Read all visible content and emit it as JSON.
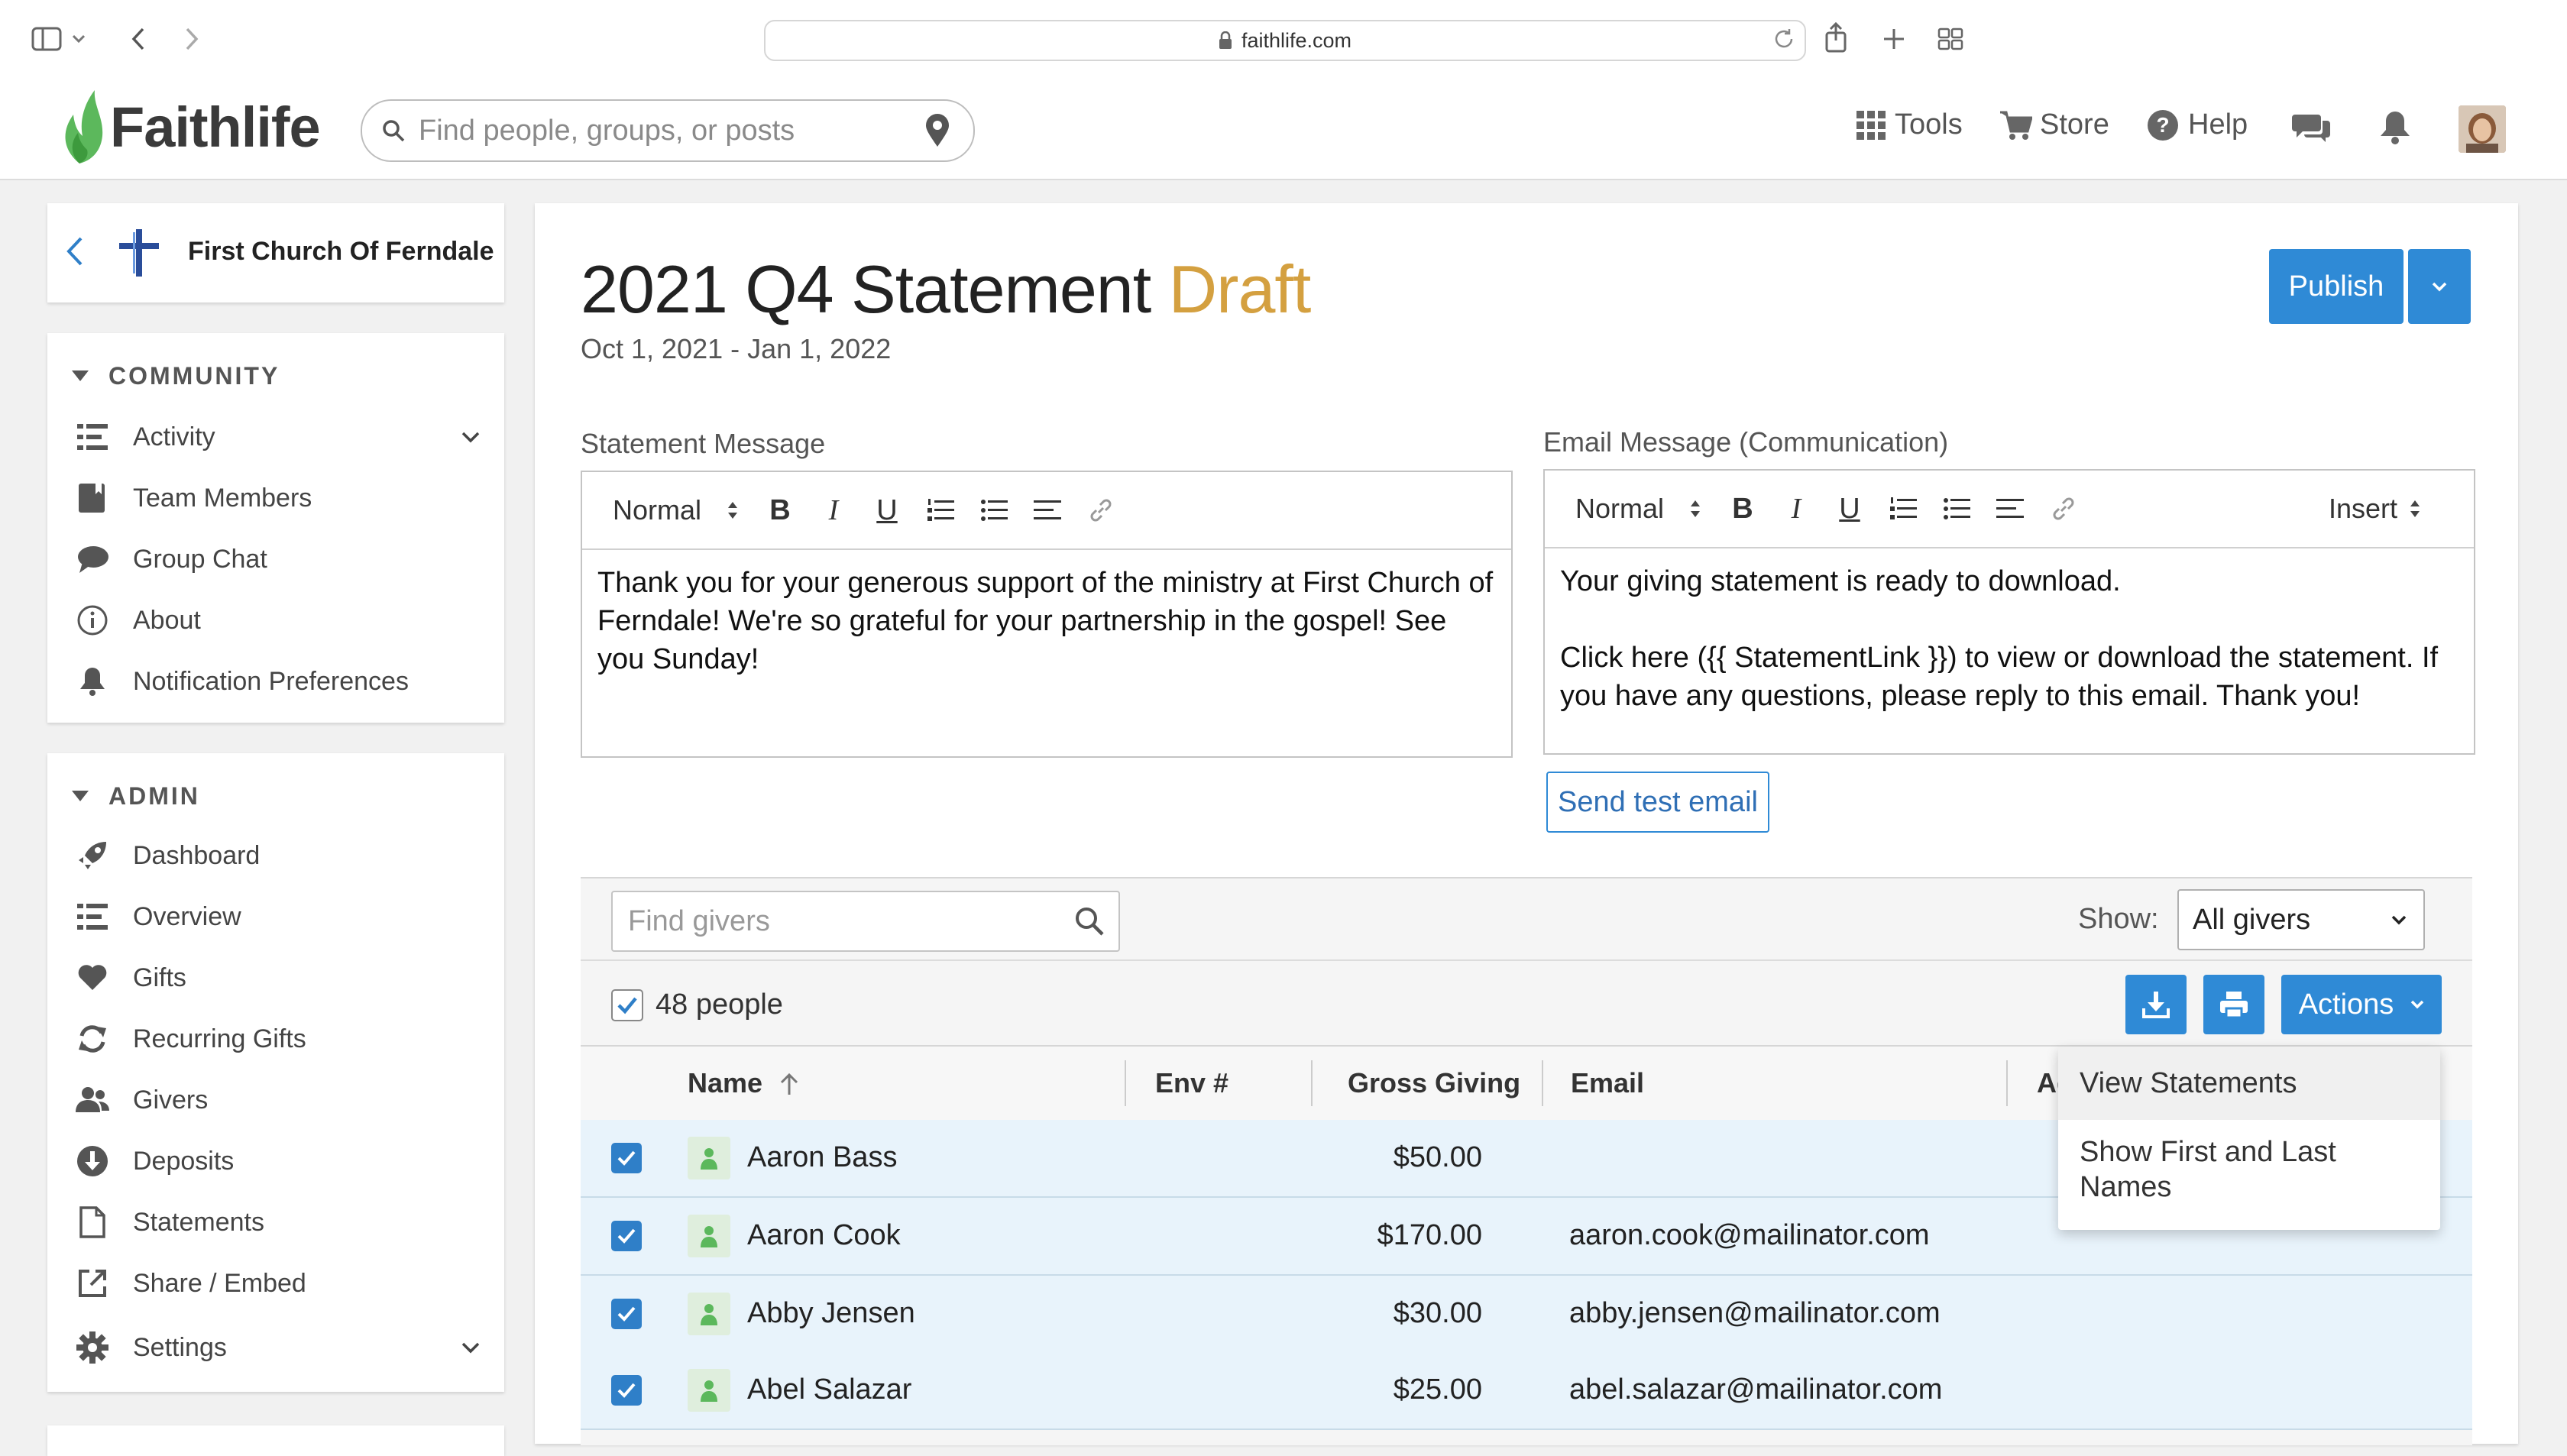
{
  "browser": {
    "url": "faithlife.com"
  },
  "header": {
    "logo_text": "Faithlife",
    "search_placeholder": "Find people, groups, or posts",
    "nav": {
      "tools": "Tools",
      "store": "Store",
      "help": "Help"
    }
  },
  "sidebar": {
    "group_name": "First Church Of Ferndale",
    "community_heading": "COMMUNITY",
    "community_items": [
      {
        "label": "Activity",
        "icon": "list-icon"
      },
      {
        "label": "Team Members",
        "icon": "bookmark-book-icon"
      },
      {
        "label": "Group Chat",
        "icon": "chat-icon"
      },
      {
        "label": "About",
        "icon": "info-icon"
      },
      {
        "label": "Notification Preferences",
        "icon": "bell-icon"
      }
    ],
    "admin_heading": "ADMIN",
    "admin_items": [
      {
        "label": "Dashboard",
        "icon": "rocket-icon"
      },
      {
        "label": "Overview",
        "icon": "list-icon"
      },
      {
        "label": "Gifts",
        "icon": "heart-icon"
      },
      {
        "label": "Recurring Gifts",
        "icon": "recurring-icon"
      },
      {
        "label": "Givers",
        "icon": "people-icon"
      },
      {
        "label": "Deposits",
        "icon": "download-circle-icon"
      },
      {
        "label": "Statements",
        "icon": "document-icon"
      },
      {
        "label": "Share / Embed",
        "icon": "external-link-icon"
      },
      {
        "label": "Settings",
        "icon": "gear-icon"
      }
    ]
  },
  "page": {
    "title": "2021 Q4 Statement",
    "status": "Draft",
    "date_range": "Oct 1, 2021 - Jan 1, 2022",
    "publish_label": "Publish",
    "statement_message_label": "Statement Message",
    "email_message_label": "Email Message (Communication)",
    "format_select": "Normal",
    "insert_label": "Insert",
    "statement_text": "Thank you for your generous support of the ministry at First Church of Ferndale! We're so grateful for your partnership in the gospel! See you Sunday!",
    "email_line1": "Your giving statement is ready to download.",
    "email_line2": "Click here ({{ StatementLink }}) to view or download the statement. If you have any questions, please reply to this email. Thank you!",
    "send_test_label": "Send test email"
  },
  "givers": {
    "search_placeholder": "Find givers",
    "show_label": "Show:",
    "show_value": "All givers",
    "count_label": "48 people",
    "actions_label": "Actions",
    "columns": {
      "name": "Name",
      "env": "Env #",
      "gross": "Gross Giving",
      "email": "Email",
      "extra": "Ad"
    },
    "rows": [
      {
        "name": "Aaron Bass",
        "gross": "$50.00",
        "email": ""
      },
      {
        "name": "Aaron Cook",
        "gross": "$170.00",
        "email": "aaron.cook@mailinator.com"
      },
      {
        "name": "Abby Jensen",
        "gross": "$30.00",
        "email": "abby.jensen@mailinator.com"
      },
      {
        "name": "Abel Salazar",
        "gross": "$25.00",
        "email": "abel.salazar@mailinator.com"
      }
    ],
    "menu": [
      "View Statements",
      "Show First and Last Names"
    ]
  },
  "colors": {
    "accent": "#2f8ad6",
    "draft": "#d4a040",
    "logo_green": "#5cb85c",
    "row_selected": "#e8f3fb"
  }
}
